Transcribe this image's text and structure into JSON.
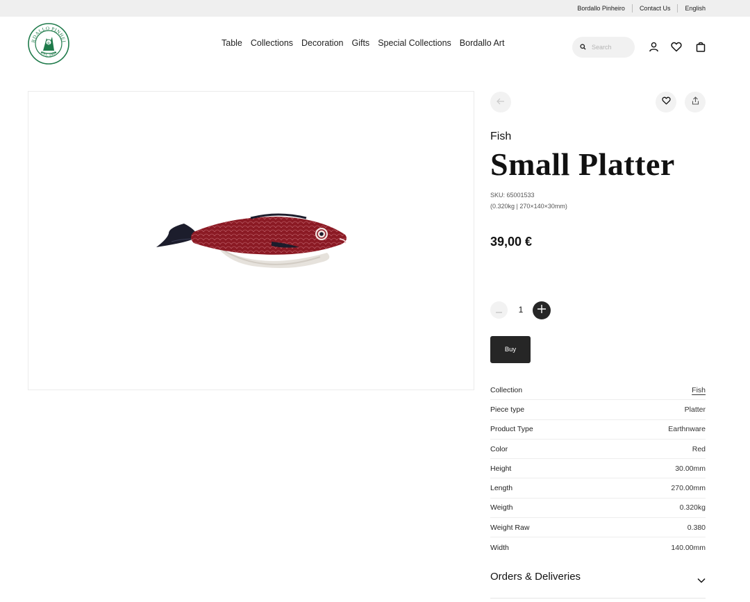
{
  "topbar": {
    "links": [
      "Bordallo Pinheiro",
      "Contact Us",
      "English"
    ]
  },
  "header": {
    "logo_name": "bordallo-pinheiro-logo",
    "logo_text_top": "BORDALLO PINHEIRO",
    "logo_text_bottom": "EST. 1884",
    "nav": [
      "Table",
      "Collections",
      "Decoration",
      "Gifts",
      "Special Collections",
      "Bordallo Art"
    ],
    "search_placeholder": "Search",
    "icons": [
      "search-icon",
      "user-icon",
      "heart-icon",
      "bag-icon"
    ]
  },
  "product": {
    "collection": "Fish",
    "title": "Small Platter",
    "sku": "SKU: 65001533",
    "dimensions": "(0.320kg | 270×140×30mm)",
    "price": "39,00 €",
    "quantity": "1",
    "buy_label": "Buy",
    "image_alt_name": "fish-platter-image"
  },
  "specs": [
    {
      "label": "Collection",
      "value": "Fish"
    },
    {
      "label": "Piece type",
      "value": "Platter"
    },
    {
      "label": "Product Type",
      "value": "Earthnware"
    },
    {
      "label": "Color",
      "value": "Red"
    },
    {
      "label": "Height",
      "value": "30.00mm"
    },
    {
      "label": "Length",
      "value": "270.00mm"
    },
    {
      "label": "Weigth",
      "value": "0.320kg"
    },
    {
      "label": "Weight Raw",
      "value": "0.380"
    },
    {
      "label": "Width",
      "value": "140.00mm"
    }
  ],
  "orders": {
    "label": "Orders & Deliveries"
  },
  "colors": {
    "brand_green": "#1e7a4a",
    "dark_button": "#262626",
    "fish_red": "#8b1a24",
    "topbar_bg": "#efefef"
  }
}
